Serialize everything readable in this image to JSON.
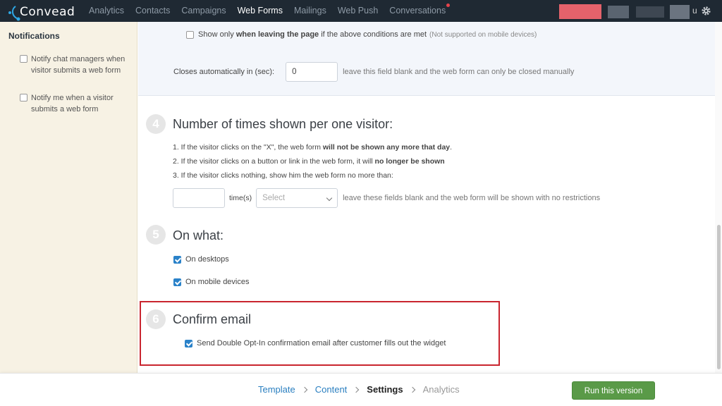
{
  "nav": {
    "logo": "Convead",
    "items": [
      "Analytics",
      "Contacts",
      "Campaigns",
      "Web Forms",
      "Mailings",
      "Web Push",
      "Conversations"
    ],
    "active": "Web Forms",
    "user_suffix": "u"
  },
  "sidebar": {
    "title": "Notifications",
    "notify_managers": "Notify chat managers when visitor submits a web form",
    "notify_me": "Notify me when a visitor submits a web form"
  },
  "leaving": {
    "prefix": "Show only ",
    "bold": "when leaving the page",
    "suffix": " if the above conditions are met",
    "note": "(Not supported on mobile devices)"
  },
  "closes": {
    "label": "Closes automatically in (sec):",
    "value": "0",
    "hint": "leave this field blank and the web form can only be closed manually"
  },
  "step4": {
    "number": "4",
    "title": "Number of times shown per one visitor:",
    "line1_pre": "1. If the visitor clicks on the \"X\", the web form ",
    "line1_bold": "will not be shown any more that day",
    "line1_post": ".",
    "line2_pre": "2. If the visitor clicks on a button or link in the web form, it will ",
    "line2_bold": "no longer be shown",
    "line3": "3. If the visitor clicks nothing, show him the web form no more than:",
    "times_value": "",
    "times_label": "time(s)",
    "select_placeholder": "Select",
    "hint": "leave these fields blank and the web form will be shown with no restrictions"
  },
  "step5": {
    "number": "5",
    "title": "On what:",
    "desktops": "On desktops",
    "mobile": "On mobile devices"
  },
  "step6": {
    "number": "6",
    "title": "Confirm email",
    "double_optin": "Send Double Opt-In confirmation email after customer fills out the widget"
  },
  "wizard": {
    "template": "Template",
    "content": "Content",
    "settings": "Settings",
    "analytics": "Analytics"
  },
  "run_button": "Run this version",
  "colors": {
    "topbar": "#1f2933",
    "accent": "#2a82c9",
    "run": "#5a9a48",
    "highlight": "#c9252f"
  }
}
